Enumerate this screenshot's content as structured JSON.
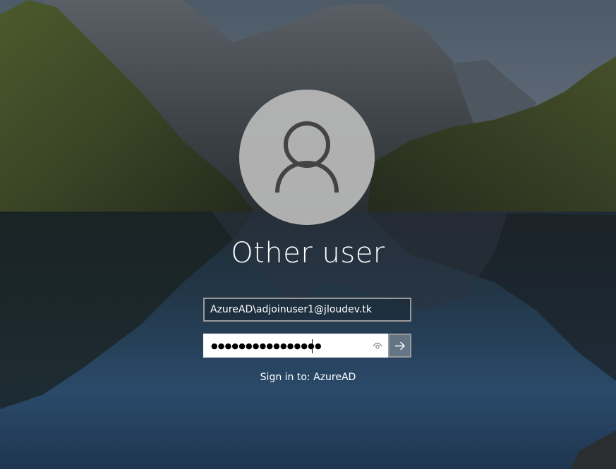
{
  "login": {
    "user_display_name": "Other user",
    "username_value": "AzureAD\\adjoinuser1@jloudev.tk",
    "password_masked": "●●●●●●●●●●●●●●●●",
    "sign_in_to": "Sign in to: AzureAD"
  },
  "icons": {
    "avatar": "user-silhouette-icon",
    "reveal": "eye-icon",
    "submit": "arrow-right-icon"
  },
  "colors": {
    "avatar_bg": "#b8b8b8",
    "field_border": "#9a9a9a",
    "text": "#ffffff"
  }
}
